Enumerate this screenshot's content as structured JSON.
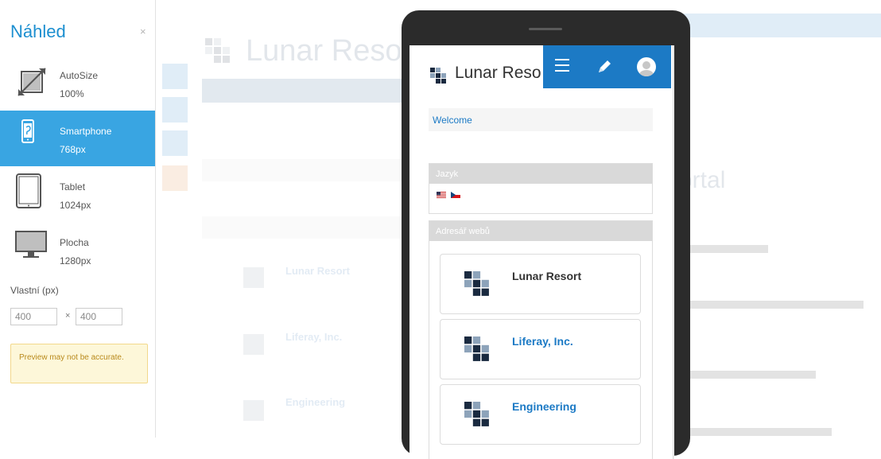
{
  "preview_panel": {
    "title": "Náhled",
    "close_glyph": "×",
    "devices": [
      {
        "name": "AutoSize",
        "size": "100%",
        "icon": "autosize-icon"
      },
      {
        "name": "Smartphone",
        "size": "768px",
        "icon": "smartphone-icon",
        "active": true
      },
      {
        "name": "Tablet",
        "size": "1024px",
        "icon": "tablet-icon"
      },
      {
        "name": "Plocha",
        "size": "1280px",
        "icon": "desktop-icon"
      }
    ],
    "custom_label": "Vlastní (px)",
    "custom_width": "400",
    "custom_height": "400",
    "custom_separator": "×",
    "warning": "Preview may not be accurate."
  },
  "background_page": {
    "site_title": "Lunar Resort",
    "heading_partial": "ortal",
    "sites": [
      "Lunar Resort",
      "Liferay, Inc.",
      "Engineering"
    ]
  },
  "mobile_preview": {
    "site_title": "Lunar Reso",
    "welcome_label": "Welcome",
    "language_panel_title": "Jazyk",
    "sites_panel_title": "Adresář webů",
    "sites": [
      "Lunar Resort",
      "Liferay, Inc.",
      "Engineering"
    ],
    "dock_icons": [
      "menu-icon",
      "pencil-icon",
      "user-avatar-icon"
    ]
  },
  "colors": {
    "accent": "#39a5e2",
    "brand_blue": "#1c7ac5",
    "title_blue": "#1c8fd0",
    "warning_bg": "#fdf7d9",
    "warning_text": "#b98a1c"
  }
}
